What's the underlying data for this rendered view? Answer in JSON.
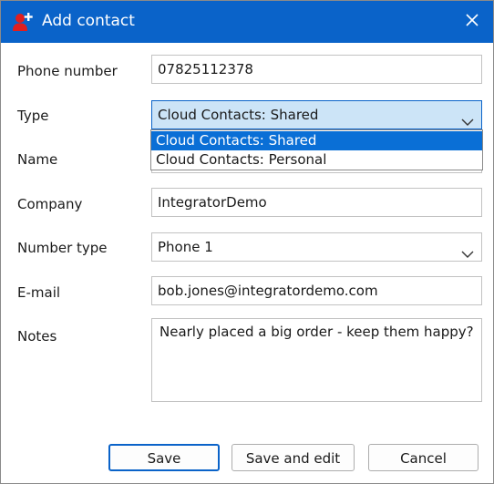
{
  "window": {
    "title": "Add contact",
    "accent_color": "#0a63c9",
    "title_icon": "add-contact-icon",
    "close_icon": "close-icon"
  },
  "form": {
    "phone_label": "Phone number",
    "phone_value": "07825112378",
    "type_label": "Type",
    "type_value": "Cloud Contacts: Shared",
    "type_options": [
      "Cloud Contacts: Shared",
      "Cloud Contacts: Personal"
    ],
    "name_label": "Name",
    "company_label": "Company",
    "company_value": "IntegratorDemo",
    "number_type_label": "Number type",
    "number_type_value": "Phone 1",
    "email_label": "E-mail",
    "email_value": "bob.jones@integratordemo.com",
    "notes_label": "Notes",
    "notes_value": "Nearly placed a big order - keep them happy?"
  },
  "buttons": {
    "save": "Save",
    "save_and_edit": "Save and edit",
    "cancel": "Cancel"
  }
}
